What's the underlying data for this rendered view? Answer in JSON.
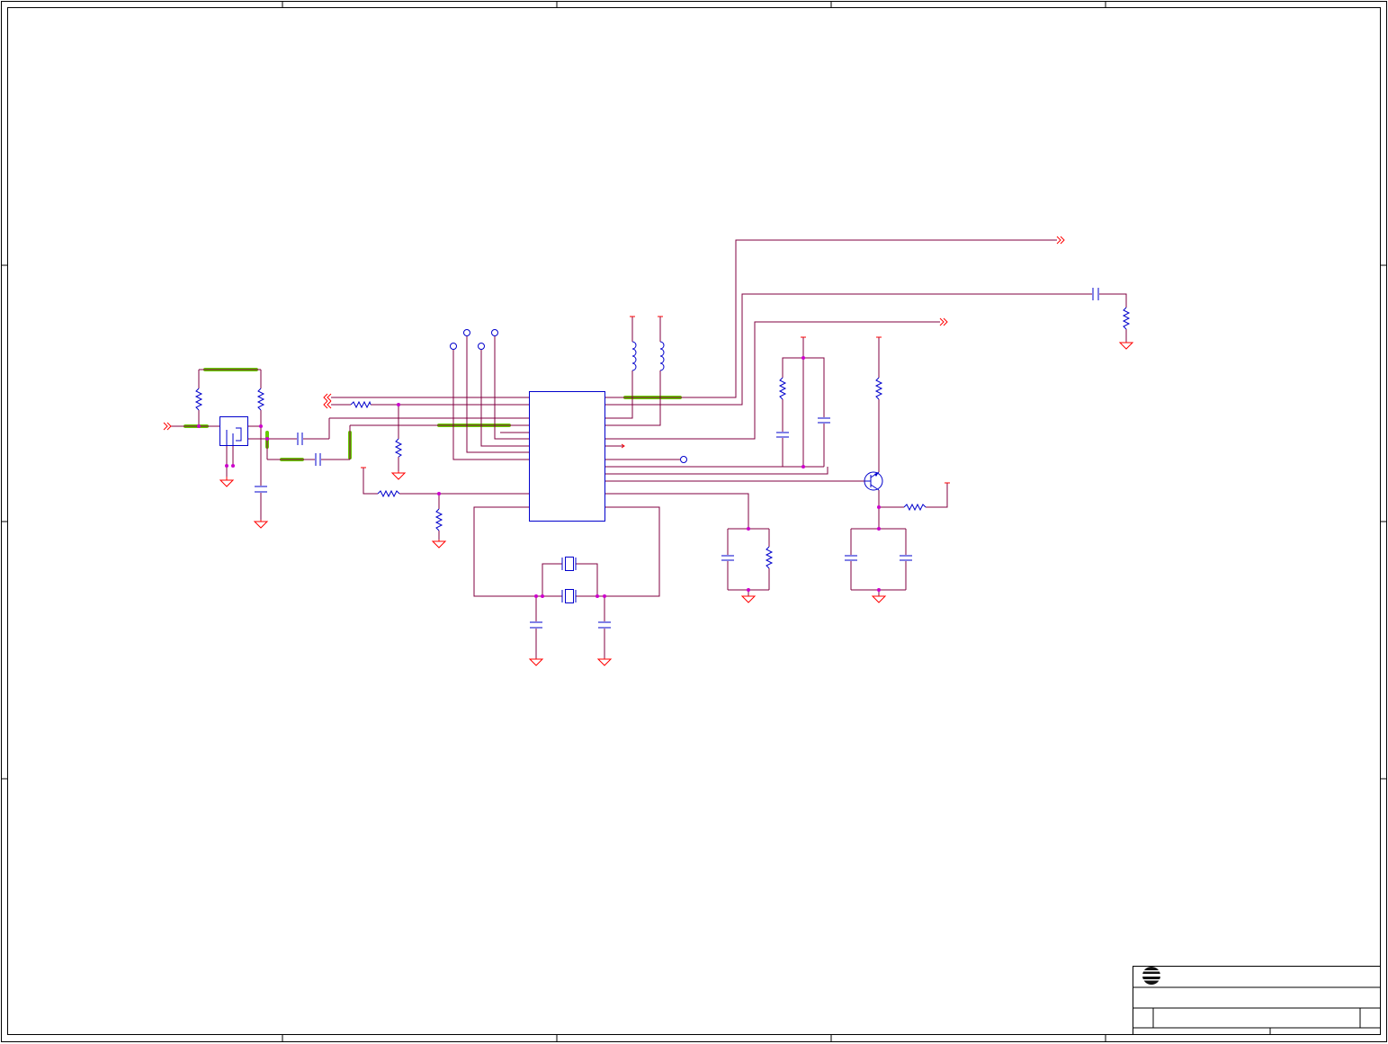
{
  "sheet": {
    "border_color": "#000000",
    "wire_color": "#800040",
    "component_color": "#0000cc",
    "power_ground_color": "#ff0000",
    "junction_color": "#cc00cc",
    "highlight_color": "#66cc00"
  },
  "title_block": {
    "logo_icon": "company-logo-icon"
  }
}
